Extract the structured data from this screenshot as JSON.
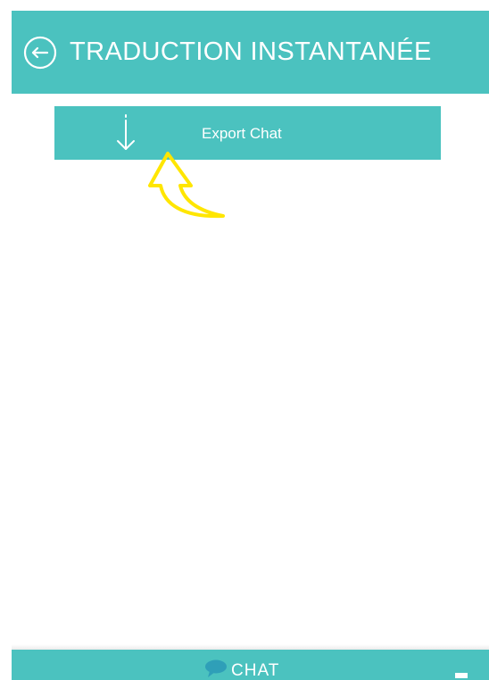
{
  "colors": {
    "accent": "#4bc2bf",
    "text_on_accent": "#ffffff",
    "annotation": "#ffe600",
    "chat_icon": "#2f9fb8"
  },
  "header": {
    "back_icon": "arrow-left-circle-icon",
    "title": "TRADUCTION INSTANTANÉE"
  },
  "export": {
    "icon": "arrow-down-icon",
    "label": "Export Chat"
  },
  "annotation": {
    "icon": "curved-arrow-pointer-icon"
  },
  "footer": {
    "chat_icon": "chat-bubble-icon",
    "chat_label": "CHAT",
    "minimize_icon": "minimize-icon"
  }
}
